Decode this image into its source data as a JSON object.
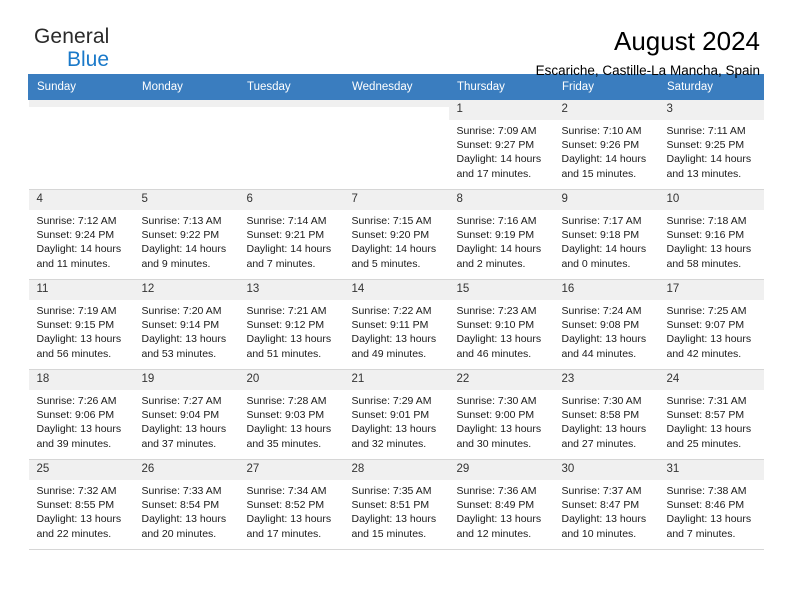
{
  "brand": {
    "name_top": "General",
    "name_bottom": "Blue",
    "triangle_color": "#1464ad",
    "blue_color": "#1a79c9"
  },
  "header": {
    "title": "August 2024",
    "subtitle": "Escariche, Castille-La Mancha, Spain"
  },
  "theme": {
    "header_row_bg": "#3a7dbf",
    "daynum_bg": "#f0f0f0",
    "grid_line": "#d6d6d6"
  },
  "weekday_headers": [
    "Sunday",
    "Monday",
    "Tuesday",
    "Wednesday",
    "Thursday",
    "Friday",
    "Saturday"
  ],
  "weeks": [
    [
      {
        "day": "",
        "empty": true,
        "sunrise": "",
        "sunset": "",
        "daylight1": "",
        "daylight2": ""
      },
      {
        "day": "",
        "empty": true,
        "sunrise": "",
        "sunset": "",
        "daylight1": "",
        "daylight2": ""
      },
      {
        "day": "",
        "empty": true,
        "sunrise": "",
        "sunset": "",
        "daylight1": "",
        "daylight2": ""
      },
      {
        "day": "",
        "empty": true,
        "sunrise": "",
        "sunset": "",
        "daylight1": "",
        "daylight2": ""
      },
      {
        "day": "1",
        "empty": false,
        "sunrise": "Sunrise: 7:09 AM",
        "sunset": "Sunset: 9:27 PM",
        "daylight1": "Daylight: 14 hours",
        "daylight2": "and 17 minutes."
      },
      {
        "day": "2",
        "empty": false,
        "sunrise": "Sunrise: 7:10 AM",
        "sunset": "Sunset: 9:26 PM",
        "daylight1": "Daylight: 14 hours",
        "daylight2": "and 15 minutes."
      },
      {
        "day": "3",
        "empty": false,
        "sunrise": "Sunrise: 7:11 AM",
        "sunset": "Sunset: 9:25 PM",
        "daylight1": "Daylight: 14 hours",
        "daylight2": "and 13 minutes."
      }
    ],
    [
      {
        "day": "4",
        "empty": false,
        "sunrise": "Sunrise: 7:12 AM",
        "sunset": "Sunset: 9:24 PM",
        "daylight1": "Daylight: 14 hours",
        "daylight2": "and 11 minutes."
      },
      {
        "day": "5",
        "empty": false,
        "sunrise": "Sunrise: 7:13 AM",
        "sunset": "Sunset: 9:22 PM",
        "daylight1": "Daylight: 14 hours",
        "daylight2": "and 9 minutes."
      },
      {
        "day": "6",
        "empty": false,
        "sunrise": "Sunrise: 7:14 AM",
        "sunset": "Sunset: 9:21 PM",
        "daylight1": "Daylight: 14 hours",
        "daylight2": "and 7 minutes."
      },
      {
        "day": "7",
        "empty": false,
        "sunrise": "Sunrise: 7:15 AM",
        "sunset": "Sunset: 9:20 PM",
        "daylight1": "Daylight: 14 hours",
        "daylight2": "and 5 minutes."
      },
      {
        "day": "8",
        "empty": false,
        "sunrise": "Sunrise: 7:16 AM",
        "sunset": "Sunset: 9:19 PM",
        "daylight1": "Daylight: 14 hours",
        "daylight2": "and 2 minutes."
      },
      {
        "day": "9",
        "empty": false,
        "sunrise": "Sunrise: 7:17 AM",
        "sunset": "Sunset: 9:18 PM",
        "daylight1": "Daylight: 14 hours",
        "daylight2": "and 0 minutes."
      },
      {
        "day": "10",
        "empty": false,
        "sunrise": "Sunrise: 7:18 AM",
        "sunset": "Sunset: 9:16 PM",
        "daylight1": "Daylight: 13 hours",
        "daylight2": "and 58 minutes."
      }
    ],
    [
      {
        "day": "11",
        "empty": false,
        "sunrise": "Sunrise: 7:19 AM",
        "sunset": "Sunset: 9:15 PM",
        "daylight1": "Daylight: 13 hours",
        "daylight2": "and 56 minutes."
      },
      {
        "day": "12",
        "empty": false,
        "sunrise": "Sunrise: 7:20 AM",
        "sunset": "Sunset: 9:14 PM",
        "daylight1": "Daylight: 13 hours",
        "daylight2": "and 53 minutes."
      },
      {
        "day": "13",
        "empty": false,
        "sunrise": "Sunrise: 7:21 AM",
        "sunset": "Sunset: 9:12 PM",
        "daylight1": "Daylight: 13 hours",
        "daylight2": "and 51 minutes."
      },
      {
        "day": "14",
        "empty": false,
        "sunrise": "Sunrise: 7:22 AM",
        "sunset": "Sunset: 9:11 PM",
        "daylight1": "Daylight: 13 hours",
        "daylight2": "and 49 minutes."
      },
      {
        "day": "15",
        "empty": false,
        "sunrise": "Sunrise: 7:23 AM",
        "sunset": "Sunset: 9:10 PM",
        "daylight1": "Daylight: 13 hours",
        "daylight2": "and 46 minutes."
      },
      {
        "day": "16",
        "empty": false,
        "sunrise": "Sunrise: 7:24 AM",
        "sunset": "Sunset: 9:08 PM",
        "daylight1": "Daylight: 13 hours",
        "daylight2": "and 44 minutes."
      },
      {
        "day": "17",
        "empty": false,
        "sunrise": "Sunrise: 7:25 AM",
        "sunset": "Sunset: 9:07 PM",
        "daylight1": "Daylight: 13 hours",
        "daylight2": "and 42 minutes."
      }
    ],
    [
      {
        "day": "18",
        "empty": false,
        "sunrise": "Sunrise: 7:26 AM",
        "sunset": "Sunset: 9:06 PM",
        "daylight1": "Daylight: 13 hours",
        "daylight2": "and 39 minutes."
      },
      {
        "day": "19",
        "empty": false,
        "sunrise": "Sunrise: 7:27 AM",
        "sunset": "Sunset: 9:04 PM",
        "daylight1": "Daylight: 13 hours",
        "daylight2": "and 37 minutes."
      },
      {
        "day": "20",
        "empty": false,
        "sunrise": "Sunrise: 7:28 AM",
        "sunset": "Sunset: 9:03 PM",
        "daylight1": "Daylight: 13 hours",
        "daylight2": "and 35 minutes."
      },
      {
        "day": "21",
        "empty": false,
        "sunrise": "Sunrise: 7:29 AM",
        "sunset": "Sunset: 9:01 PM",
        "daylight1": "Daylight: 13 hours",
        "daylight2": "and 32 minutes."
      },
      {
        "day": "22",
        "empty": false,
        "sunrise": "Sunrise: 7:30 AM",
        "sunset": "Sunset: 9:00 PM",
        "daylight1": "Daylight: 13 hours",
        "daylight2": "and 30 minutes."
      },
      {
        "day": "23",
        "empty": false,
        "sunrise": "Sunrise: 7:30 AM",
        "sunset": "Sunset: 8:58 PM",
        "daylight1": "Daylight: 13 hours",
        "daylight2": "and 27 minutes."
      },
      {
        "day": "24",
        "empty": false,
        "sunrise": "Sunrise: 7:31 AM",
        "sunset": "Sunset: 8:57 PM",
        "daylight1": "Daylight: 13 hours",
        "daylight2": "and 25 minutes."
      }
    ],
    [
      {
        "day": "25",
        "empty": false,
        "sunrise": "Sunrise: 7:32 AM",
        "sunset": "Sunset: 8:55 PM",
        "daylight1": "Daylight: 13 hours",
        "daylight2": "and 22 minutes."
      },
      {
        "day": "26",
        "empty": false,
        "sunrise": "Sunrise: 7:33 AM",
        "sunset": "Sunset: 8:54 PM",
        "daylight1": "Daylight: 13 hours",
        "daylight2": "and 20 minutes."
      },
      {
        "day": "27",
        "empty": false,
        "sunrise": "Sunrise: 7:34 AM",
        "sunset": "Sunset: 8:52 PM",
        "daylight1": "Daylight: 13 hours",
        "daylight2": "and 17 minutes."
      },
      {
        "day": "28",
        "empty": false,
        "sunrise": "Sunrise: 7:35 AM",
        "sunset": "Sunset: 8:51 PM",
        "daylight1": "Daylight: 13 hours",
        "daylight2": "and 15 minutes."
      },
      {
        "day": "29",
        "empty": false,
        "sunrise": "Sunrise: 7:36 AM",
        "sunset": "Sunset: 8:49 PM",
        "daylight1": "Daylight: 13 hours",
        "daylight2": "and 12 minutes."
      },
      {
        "day": "30",
        "empty": false,
        "sunrise": "Sunrise: 7:37 AM",
        "sunset": "Sunset: 8:47 PM",
        "daylight1": "Daylight: 13 hours",
        "daylight2": "and 10 minutes."
      },
      {
        "day": "31",
        "empty": false,
        "sunrise": "Sunrise: 7:38 AM",
        "sunset": "Sunset: 8:46 PM",
        "daylight1": "Daylight: 13 hours",
        "daylight2": "and 7 minutes."
      }
    ]
  ]
}
